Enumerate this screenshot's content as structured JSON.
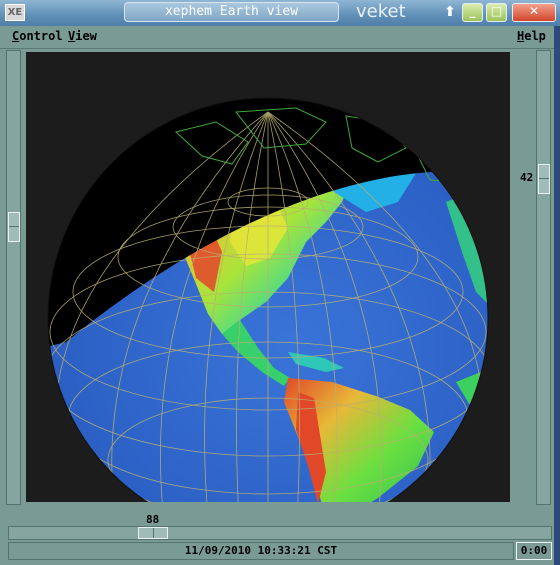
{
  "window": {
    "logo": "XE",
    "title": "xephem Earth view",
    "host": "veket",
    "buttons": {
      "up": "⬆",
      "minimize": "_",
      "maximize": "□",
      "close": "✕"
    }
  },
  "menu": {
    "control": {
      "first": "C",
      "rest": "ontrol"
    },
    "view": {
      "first": "V",
      "rest": "iew"
    },
    "help": {
      "first": "H",
      "rest": "elp"
    }
  },
  "sliders": {
    "latitude": "42",
    "longitude": "88"
  },
  "status": {
    "datetime": "11/09/2010 10:33:21 CST",
    "clock": "0:00"
  },
  "icons": {
    "logo": "xephem-logo-icon",
    "up": "arrow-up-icon",
    "minimize": "minimize-icon",
    "maximize": "maximize-icon",
    "close": "close-icon"
  },
  "colors": {
    "panel": "#7a9b94",
    "canvas": "#1d1c1d",
    "grid": "#b9b070",
    "coast": "#3fa83a",
    "ocean": "#2f63c8",
    "land_low": "#2ee07a",
    "land_mid": "#e8e23a",
    "land_high": "#e2452a"
  }
}
